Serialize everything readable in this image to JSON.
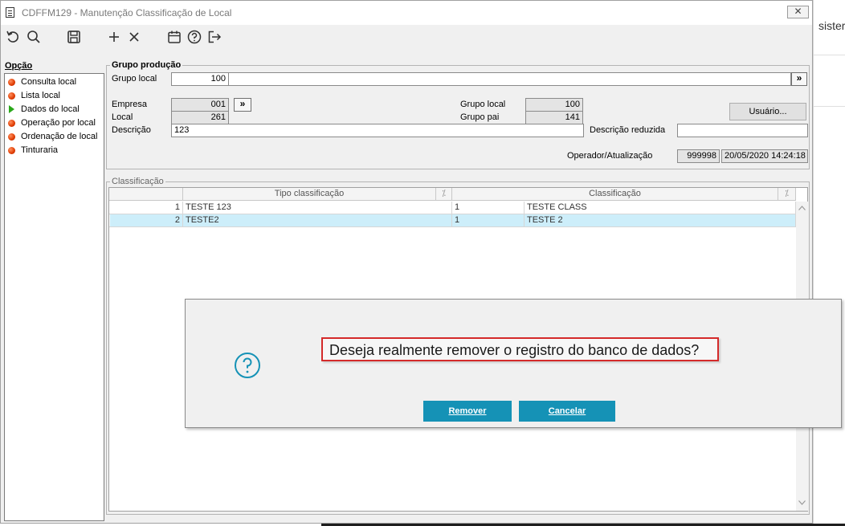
{
  "background_app": {
    "partial_text": "sister"
  },
  "window": {
    "title": "CDFFM129 - Manutenção Classificação de Local",
    "close_label": "✕"
  },
  "toolbar": {
    "icons": [
      "refresh-icon",
      "search-icon",
      "save-icon",
      "add-icon",
      "delete-icon",
      "calendar-icon",
      "help-icon",
      "exit-icon"
    ]
  },
  "sidebar": {
    "title": "Opção",
    "items": [
      {
        "label": "Consulta local",
        "marker": "red-dot"
      },
      {
        "label": "Lista local",
        "marker": "red-dot"
      },
      {
        "label": "Dados do local",
        "marker": "green-arrow"
      },
      {
        "label": "Operação por local",
        "marker": "red-dot"
      },
      {
        "label": "Ordenação de local",
        "marker": "red-dot"
      },
      {
        "label": "Tinturaria",
        "marker": "red-dot"
      }
    ]
  },
  "grupo_producao": {
    "title": "Grupo produção",
    "grupo_local_label": "Grupo local",
    "grupo_local_value": "100",
    "grupo_local_desc": "",
    "empresa_label": "Empresa",
    "empresa_value": "001",
    "local_label": "Local",
    "local_value": "261",
    "descricao_label": "Descrição",
    "descricao_value": "123",
    "grupo_local2_label": "Grupo local",
    "grupo_local2_value": "100",
    "grupo_pai_label": "Grupo pai",
    "grupo_pai_value": "141",
    "usuario_button": "Usuário...",
    "descricao_reduzida_label": "Descrição reduzida",
    "descricao_reduzida_value": "",
    "operador_label": "Operador/Atualização",
    "operador_value": "999998",
    "atualizacao_value": "20/05/2020 14:24:18",
    "lookup_button": "»"
  },
  "classificacao": {
    "title": "Classificação",
    "columns": [
      "Tipo classificação",
      "Classificação"
    ],
    "rows": [
      {
        "num": "1",
        "tipo": "TESTE 123",
        "cls_num": "1",
        "cls": "TESTE CLASS"
      },
      {
        "num": "2",
        "tipo": "TESTE2",
        "cls_num": "1",
        "cls": "TESTE 2"
      }
    ]
  },
  "dialog": {
    "message": "Deseja realmente remover o registro do banco de dados?",
    "confirm_label": "Remover",
    "cancel_label": "Cancelar",
    "accent_color": "#1592b6",
    "highlight_color": "#d42a2a"
  }
}
